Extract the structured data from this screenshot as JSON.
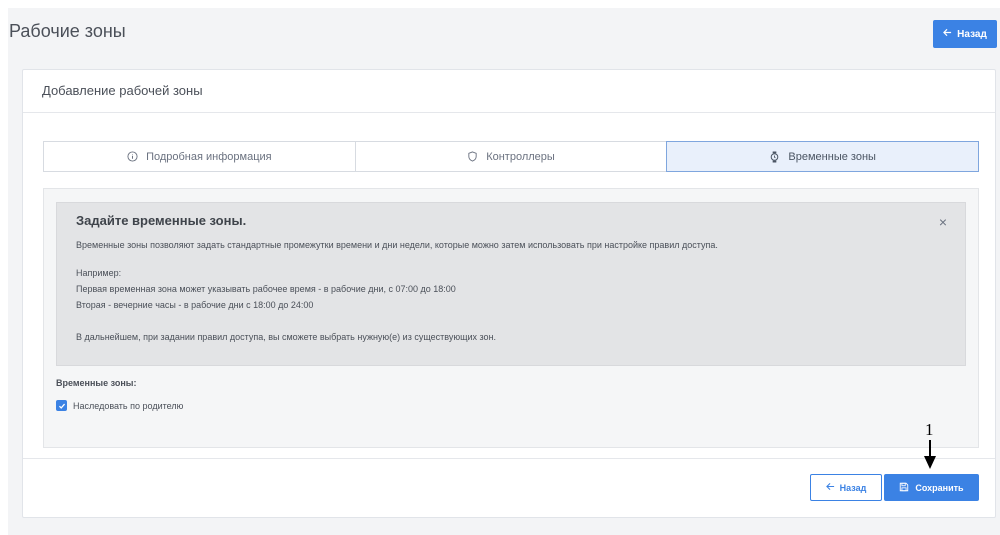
{
  "page": {
    "title": "Рабочие зоны",
    "back_label": "Назад"
  },
  "card": {
    "title": "Добавление рабочей зоны"
  },
  "tabs": [
    {
      "label": "Подробная информация",
      "icon": "info-circle-icon",
      "active": false
    },
    {
      "label": "Контроллеры",
      "icon": "shield-icon",
      "active": false
    },
    {
      "label": "Временные зоны",
      "icon": "watch-icon",
      "active": true
    }
  ],
  "alert": {
    "title": "Задайте временные зоны.",
    "close_glyph": "×",
    "description": "Временные зоны позволяют задать стандартные промежутки времени и дни недели, которые можно затем использовать при настройке правил доступа.",
    "example_label": "Например:",
    "example_line1": "Первая временная зона может указывать рабочее время - в рабочие дни, с 07:00 до 18:00",
    "example_line2": "Вторая - вечерние часы - в рабочие дни с 18:00 до 24:00",
    "footer": "В дальнейшем, при задании правил доступа, вы сможете выбрать нужную(е) из существующих зон."
  },
  "form": {
    "section_label": "Временные зоны:",
    "inherit_label": "Наследовать по родителю",
    "inherit_checked": true
  },
  "footer": {
    "back_label": "Назад",
    "save_label": "Сохранить"
  },
  "annotation": {
    "number": "1"
  },
  "colors": {
    "primary": "#3b82e4",
    "active_tab_bg": "#e9f0fb",
    "alert_bg": "#e3e4e6"
  }
}
